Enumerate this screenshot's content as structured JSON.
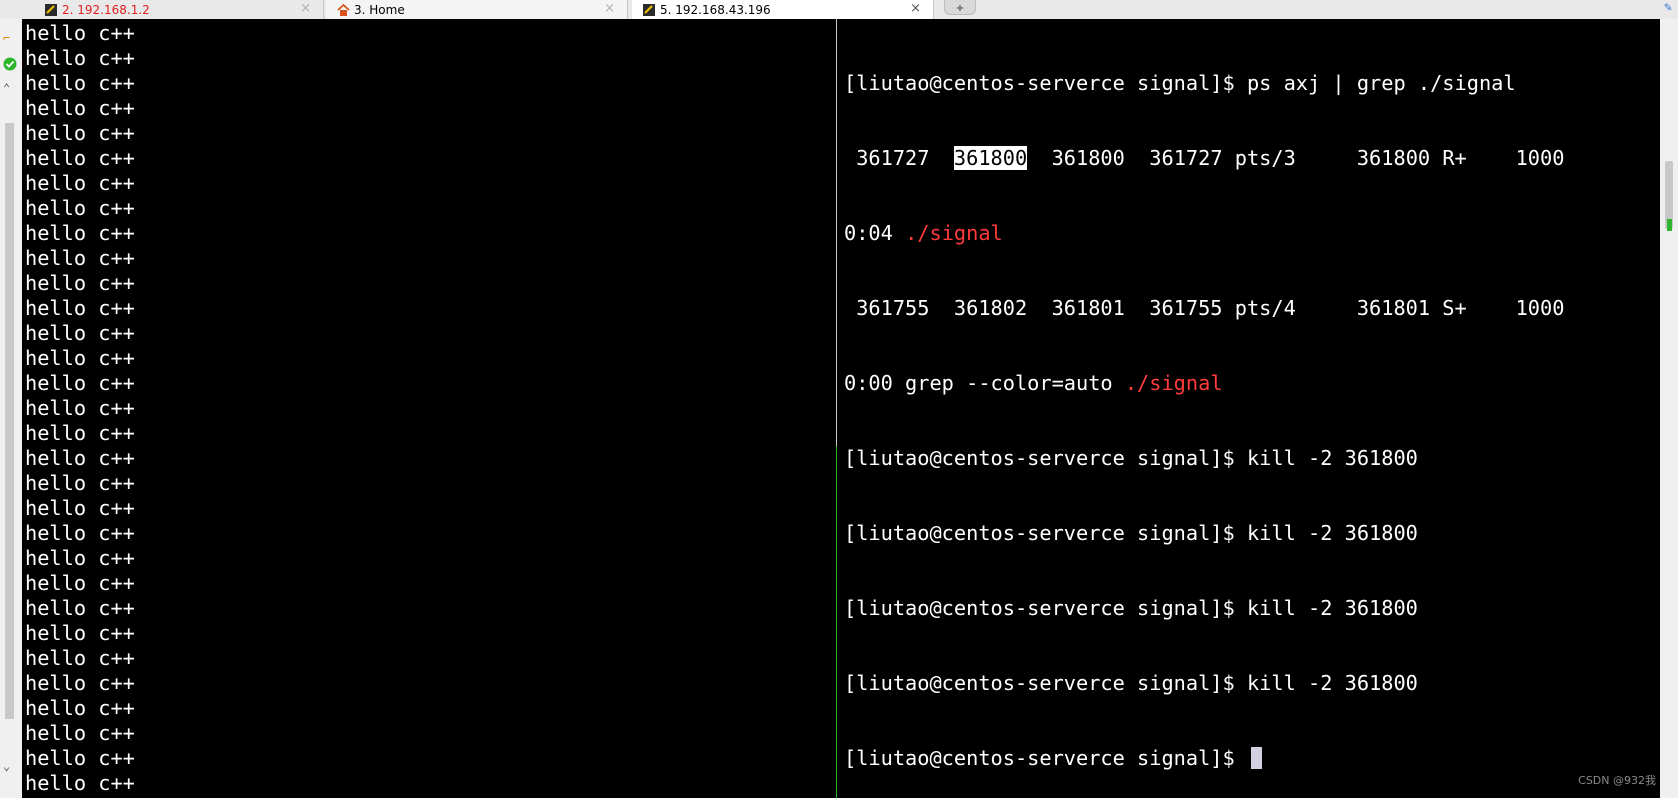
{
  "tabs": [
    {
      "label": "2. 192.168.1.2",
      "icon": "terminal-icon",
      "color": "#e02020"
    },
    {
      "label": "3. Home",
      "icon": "home-icon",
      "color": "#222222"
    },
    {
      "label": "5. 192.168.43.196",
      "icon": "terminal-icon",
      "color": "#222222"
    }
  ],
  "tab_close": "×",
  "left_terminal": {
    "lines": [
      "hello c++",
      "hello c++",
      "hello c++",
      "hello c++",
      "hello c++",
      "hello c++",
      "hello c++",
      "hello c++",
      "hello c++",
      "hello c++",
      "hello c++",
      "hello c++",
      "hello c++",
      "hello c++",
      "hello c++",
      "hello c++",
      "hello c++",
      "hello c++",
      "hello c++",
      "hello c++",
      "hello c++",
      "hello c++",
      "hello c++",
      "hello c++",
      "hello c++",
      "hello c++",
      "hello c++",
      "hello c++",
      "hello c++",
      "hello c++",
      "hello c++",
      "hello c++"
    ]
  },
  "right_terminal": {
    "line1": "[liutao@centos-serverce signal]$ ps axj | grep ./signal",
    "line2_pre": " 361727  ",
    "line2_hl": "361800",
    "line2_post": "  361800  361727 pts/3     361800 R+    1000",
    "line3_pre": "0:04 ",
    "line3_red": "./signal",
    "line4": " 361755  361802  361801  361755 pts/4     361801 S+    1000",
    "line5_pre": "0:00 grep --color=auto ",
    "line5_red": "./signal",
    "kill_lines": [
      "[liutao@centos-serverce signal]$ kill -2 361800",
      "[liutao@centos-serverce signal]$ kill -2 361800",
      "[liutao@centos-serverce signal]$ kill -2 361800",
      "[liutao@centos-serverce signal]$ kill -2 361800"
    ],
    "prompt": "[liutao@centos-serverce signal]$ "
  },
  "watermark": "CSDN @932我",
  "colors": {
    "background": "#000000",
    "text": "#ffffff",
    "red": "#ff3b3b",
    "divider_active": "#2db52d"
  }
}
